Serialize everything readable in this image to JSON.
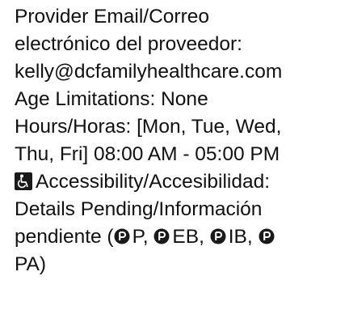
{
  "provider": {
    "email_label_line1": "Provider Email/Correo",
    "email_label_line2": "electrónico del proveedor:",
    "email_value": "kelly@dcfamilyhealthcare.com",
    "age_limitations": "Age Limitations: None",
    "hours_line1": "Hours/Horas: [Mon, Tue, Wed,",
    "hours_line2": "Thu, Fri] 08:00 AM - 05:00 PM",
    "accessibility_label": "Accessibility/Accesibilidad:",
    "accessibility_details": "Details Pending/Información",
    "pending_prefix": "pendiente (",
    "parking": [
      {
        "label": "P",
        "suffix": ", "
      },
      {
        "label": "EB",
        "suffix": ", "
      },
      {
        "label": "IB",
        "suffix": ", "
      },
      {
        "label": "PA",
        "suffix": ")"
      }
    ]
  },
  "icons": {
    "accessibility": "wheelchair-icon",
    "parking": "parking-badge-icon"
  },
  "colors": {
    "text": "#111111",
    "icon_fill": "#1a1a1a"
  }
}
